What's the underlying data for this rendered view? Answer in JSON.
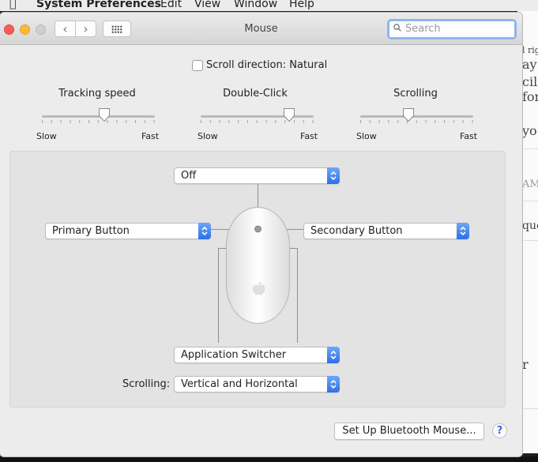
{
  "menubar": {
    "apple_icon": "apple-logo-icon",
    "app_name": "System Preferences",
    "items": [
      "Edit",
      "View",
      "Window",
      "Help"
    ]
  },
  "window": {
    "title": "Mouse",
    "search_placeholder": "Search",
    "search_value": ""
  },
  "scroll_direction": {
    "label": "Scroll direction: Natural",
    "checked": false
  },
  "sliders": [
    {
      "title": "Tracking speed",
      "min_label": "Slow",
      "max_label": "Fast",
      "value": 0.55
    },
    {
      "title": "Double-Click",
      "min_label": "Slow",
      "max_label": "Fast",
      "value": 0.78
    },
    {
      "title": "Scrolling",
      "min_label": "Slow",
      "max_label": "Fast",
      "value": 0.43
    }
  ],
  "buttons_panel": {
    "top_button": "Off",
    "left_button": "Primary Button",
    "right_button": "Secondary Button",
    "side_button": "Application Switcher",
    "scrolling_label": "Scrolling:",
    "scrolling_value": "Vertical and Horizontal"
  },
  "footer": {
    "setup_bluetooth": "Set Up Bluetooth Mouse...",
    "help": "?"
  },
  "background_window": {
    "fragments": [
      "l rig",
      "ay",
      "cilit",
      "for",
      "yo",
      "AM",
      "ques",
      "r"
    ]
  },
  "colors": {
    "accent": "#2d6fe6",
    "close": "#fd5c55",
    "minimize": "#fdbb2d",
    "search_focus": "#8fb6ef"
  }
}
